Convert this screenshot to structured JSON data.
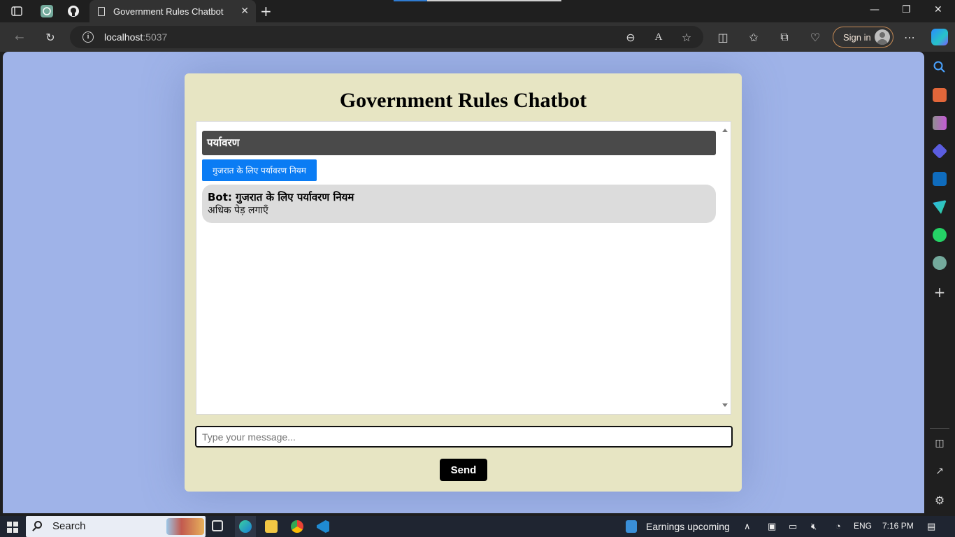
{
  "browser": {
    "tab_title": "Government Rules Chatbot",
    "url_host": "localhost",
    "url_port": ":5037",
    "signin_label": "Sign in"
  },
  "page": {
    "title": "Government Rules Chatbot",
    "topic_header": "पर्यावरण",
    "option_button": "गुजरात के लिए पर्यावरण नियम",
    "bot_message": {
      "prefix": "Bot:",
      "title": " गुजरात के लिए पर्यावरण नियम",
      "body": "अधिक पेड़ लगाएँ"
    },
    "input": {
      "value": "",
      "placeholder": "Type your message..."
    },
    "send_label": "Send"
  },
  "taskbar": {
    "search_label": "Search",
    "news_label": "Earnings upcoming",
    "language": "ENG",
    "time": "7:16 PM"
  },
  "colors": {
    "page_background": "#9fb3e8",
    "card_background": "#e7e5c3",
    "option_button": "#0a7cf4",
    "topic_bar": "#4a4a4a",
    "bot_bubble": "#dcdcdc"
  }
}
